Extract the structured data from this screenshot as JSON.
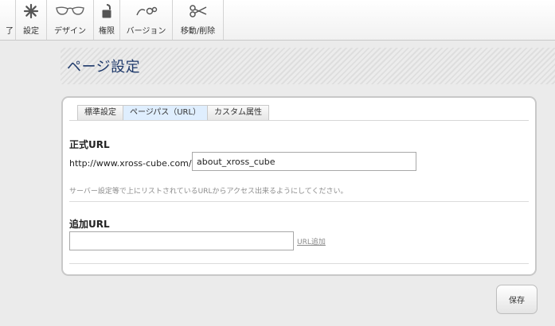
{
  "toolbar": {
    "items": [
      {
        "label": "完了",
        "visible_label": "了",
        "icon": "check-icon"
      },
      {
        "label": "設定",
        "icon": "asterisk-icon"
      },
      {
        "label": "デザイン",
        "icon": "glasses-icon"
      },
      {
        "label": "権限",
        "icon": "lock-icon"
      },
      {
        "label": "バージョン",
        "icon": "versions-icon"
      },
      {
        "label": "移動/削除",
        "icon": "scissors-icon"
      }
    ]
  },
  "page": {
    "title": "ページ設定"
  },
  "tabs": [
    {
      "label": "標準設定",
      "active": false
    },
    {
      "label": "ページパス（URL）",
      "active": true
    },
    {
      "label": "カスタム属性",
      "active": false
    }
  ],
  "canonical": {
    "label": "正式URL",
    "prefix": "http://www.xross-cube.com/",
    "value": "about_xross_cube",
    "help": "サーバー設定等で上にリストされているURLからアクセス出来るようにしてください。"
  },
  "additional": {
    "label": "追加URL",
    "value": "",
    "add_link": "URL追加"
  },
  "save_button": "保存",
  "colors": {
    "title": "#1f3a6b",
    "active_tab": "#dfeefe"
  }
}
